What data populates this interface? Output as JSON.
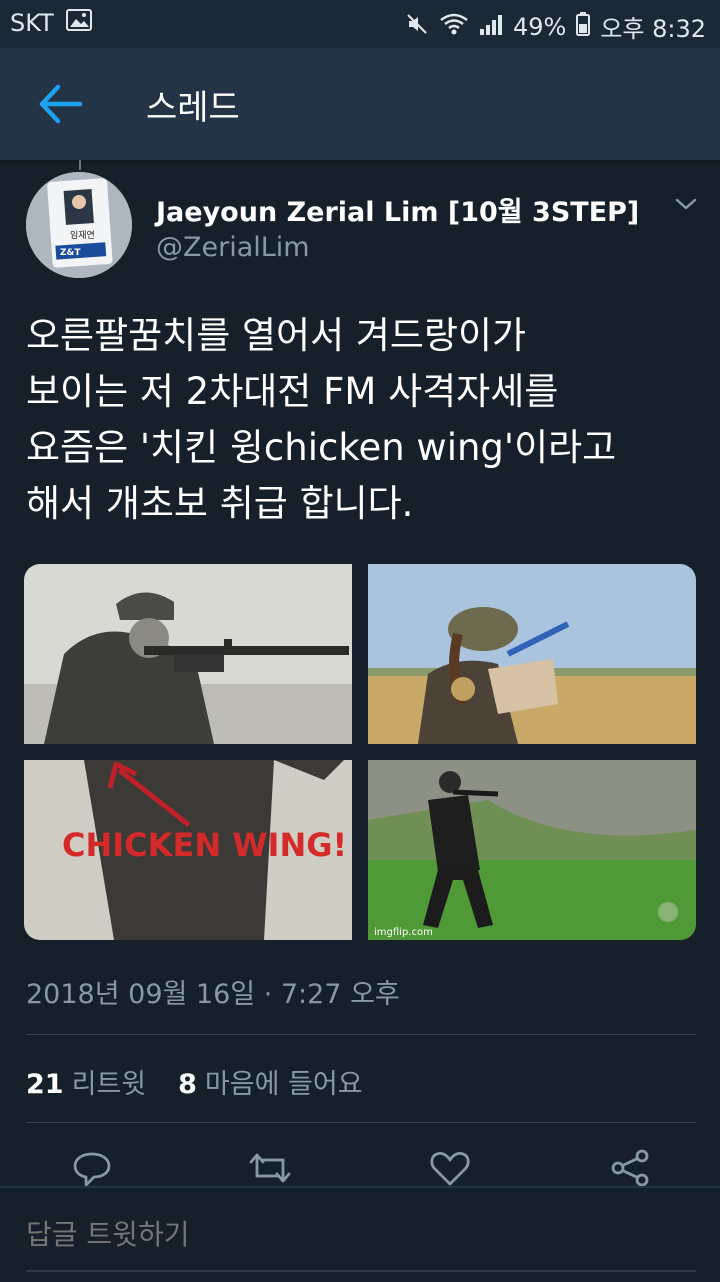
{
  "status_bar": {
    "carrier": "SKT",
    "battery": "49%",
    "time": "오후 8:32"
  },
  "app_bar": {
    "title": "스레드"
  },
  "tweet": {
    "author_name": "Jaeyoun Zerial Lim [10월 3STEP]",
    "author_handle": "@ZerialLim",
    "text": "오른팔꿈치를 열어서 겨드랑이가\n보이는 저 2차대전 FM 사격자세를\n요즘은 '치킨 윙chicken wing'이라고\n해서 개초보 취급 합니다.",
    "media": {
      "m3_caption": "CHICKEN WING!",
      "m4_watermark": "imgflip.com",
      "avatar_badge_name": "임재연",
      "avatar_badge_logo": "Z&T"
    },
    "timestamp": "2018년 09월 16일 · 7:27 오후",
    "retweet_count": "21",
    "retweet_label": "리트윗",
    "like_count": "8",
    "like_label": "마음에 들어요"
  },
  "reply": {
    "placeholder": "답글 트윗하기"
  },
  "colors": {
    "background": "#15202b",
    "app_bar": "#243447",
    "accent": "#1da1f2",
    "secondary_text": "#8899a6"
  },
  "icons": [
    "image-icon",
    "mute-icon",
    "wifi-icon",
    "signal-icon",
    "battery-icon",
    "back-arrow-icon",
    "chevron-down-icon",
    "reply-icon",
    "retweet-icon",
    "like-icon",
    "share-icon"
  ]
}
